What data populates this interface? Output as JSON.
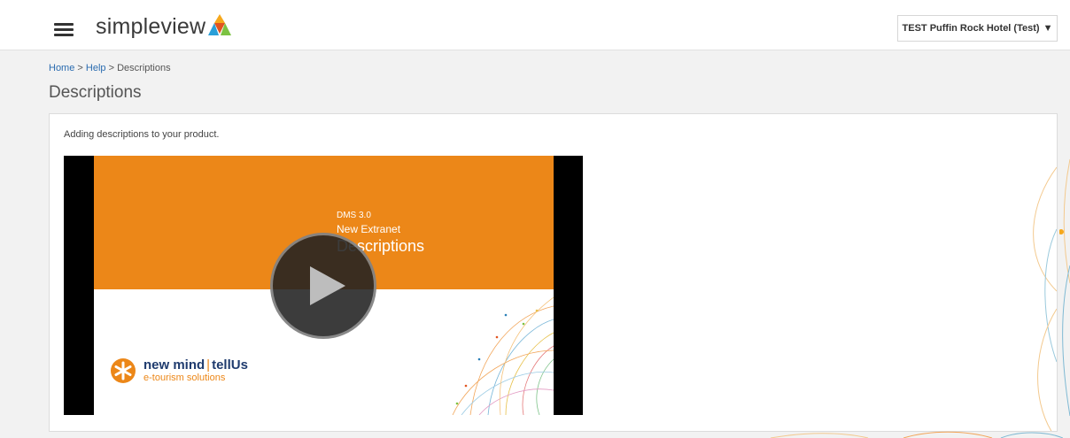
{
  "header": {
    "logo_text": "simpleview",
    "account_label": "TEST Puffin Rock Hotel (Test)",
    "account_caret": "▼"
  },
  "breadcrumb": {
    "home": "Home",
    "help": "Help",
    "current": "Descriptions",
    "separator": ">"
  },
  "page": {
    "title": "Descriptions",
    "intro": "Adding descriptions to your product."
  },
  "video": {
    "line1": "DMS 3.0",
    "line2": "New Extranet",
    "line3": "Descriptions",
    "brand_name": "new mind",
    "brand_sep": "|",
    "brand_partner": "tellUs",
    "brand_tagline": "e-tourism solutions"
  },
  "colors": {
    "accent_orange": "#ec8718",
    "link_blue": "#2b6cb0",
    "brand_navy": "#1f3b6e"
  },
  "icons": {
    "menu": "hamburger-icon",
    "play": "play-icon",
    "caret": "caret-down-icon"
  }
}
